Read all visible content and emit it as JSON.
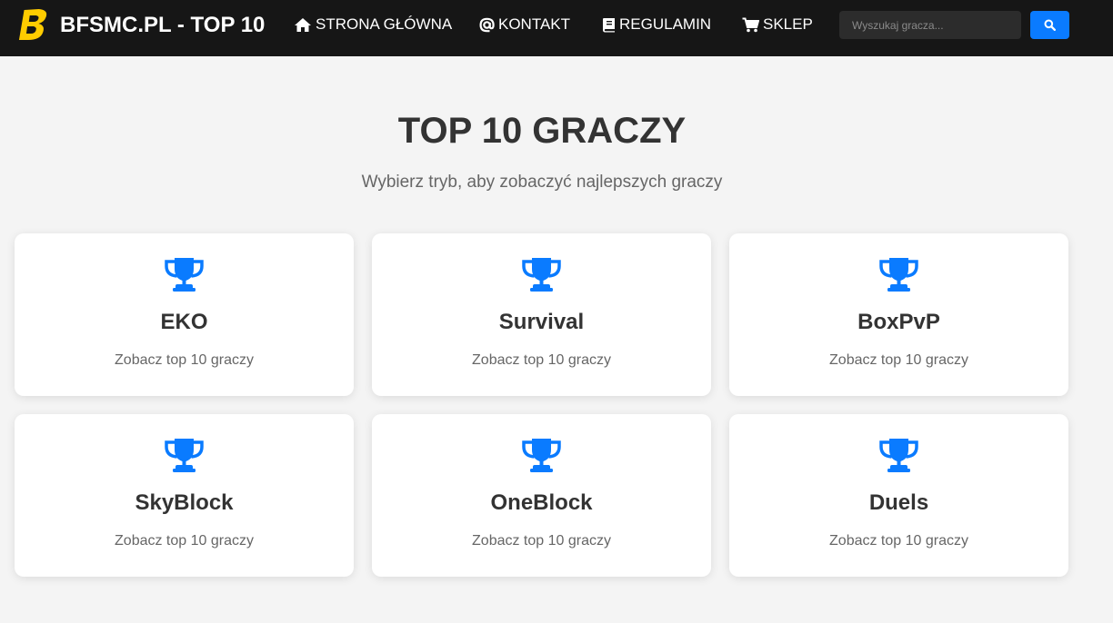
{
  "colors": {
    "navbar_bg": "#161616",
    "page_bg": "#f4f4f4",
    "accent": "#0a7bff",
    "logo_yellow": "#ffcc00",
    "heading": "#333333",
    "muted": "#666666"
  },
  "header": {
    "logo_icon": "bfsmc-logo",
    "brand": "BFSMC.PL - TOP 10",
    "nav": [
      {
        "label": "STRONA GŁÓWNA",
        "icon": "home-icon"
      },
      {
        "label": "KONTAKT",
        "icon": "at-icon"
      },
      {
        "label": "REGULAMIN",
        "icon": "book-icon"
      },
      {
        "label": "SKLEP",
        "icon": "cart-icon"
      }
    ],
    "search": {
      "placeholder": "Wyszukaj gracza...",
      "value": "",
      "button_icon": "search-icon"
    }
  },
  "main": {
    "title": "TOP 10 GRACZY",
    "subtitle": "Wybierz tryb, aby zobaczyć najlepszych graczy",
    "card_icon": "trophy-icon",
    "cards": [
      {
        "title": "EKO",
        "desc": "Zobacz top 10 graczy"
      },
      {
        "title": "Survival",
        "desc": "Zobacz top 10 graczy"
      },
      {
        "title": "BoxPvP",
        "desc": "Zobacz top 10 graczy"
      },
      {
        "title": "SkyBlock",
        "desc": "Zobacz top 10 graczy"
      },
      {
        "title": "OneBlock",
        "desc": "Zobacz top 10 graczy"
      },
      {
        "title": "Duels",
        "desc": "Zobacz top 10 graczy"
      }
    ]
  }
}
